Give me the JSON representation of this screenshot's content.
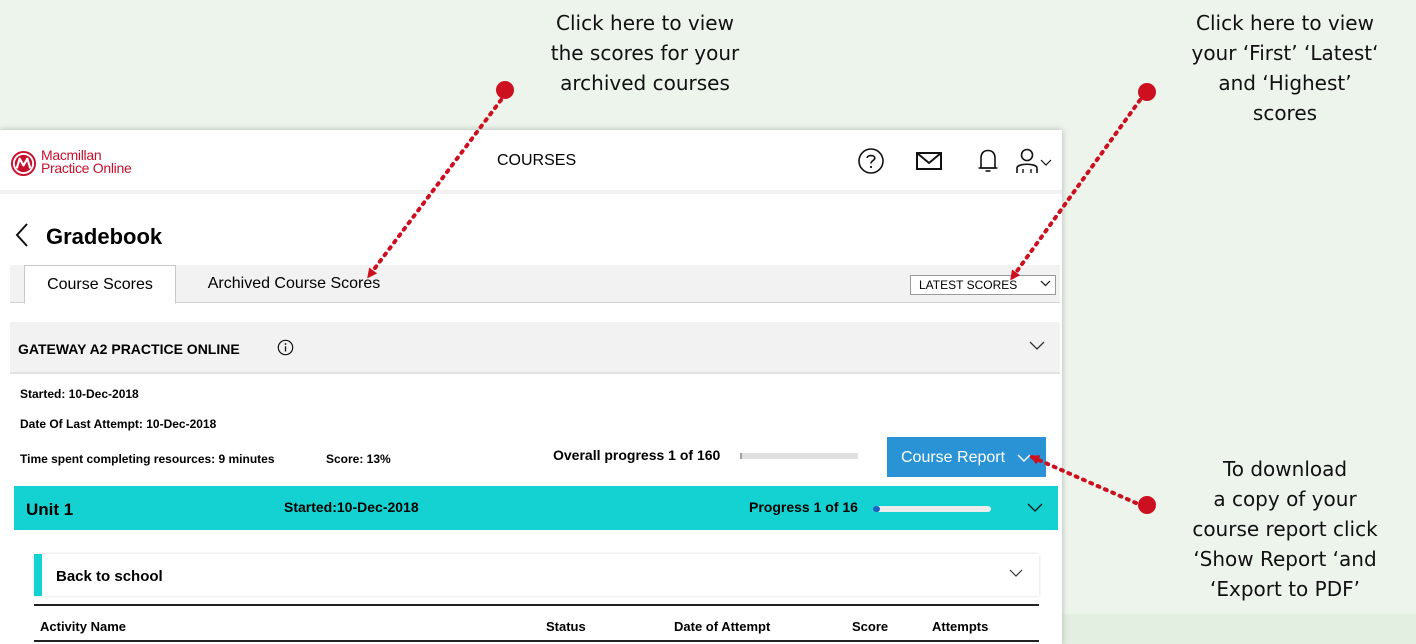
{
  "callouts": {
    "archived": [
      "Click here to view",
      "the scores for your",
      "archived courses"
    ],
    "scores": [
      "Click here to view",
      "your ‘First’ ‘Latest‘",
      "and ‘Highest’",
      "scores"
    ],
    "report": [
      "To download",
      "a copy of your",
      "course report click",
      "‘Show Report ‘and",
      "‘Export to PDF’"
    ]
  },
  "header": {
    "logo_line1": "Macmillan",
    "logo_line2": "Practice Online",
    "nav_label": "COURSES",
    "icons": [
      "help-icon",
      "mail-icon",
      "bell-icon",
      "user-icon",
      "chevron-down-icon"
    ]
  },
  "page": {
    "title": "Gradebook"
  },
  "tabs": [
    {
      "label": "Course Scores",
      "active": true
    },
    {
      "label": "Archived Course Scores",
      "active": false
    }
  ],
  "scores_select": {
    "value": "LATEST SCORES"
  },
  "course": {
    "name": "GATEWAY A2 PRACTICE ONLINE",
    "started": "Started: 10-Dec-2018",
    "last_attempt": "Date Of Last Attempt: 10-Dec-2018",
    "time_spent": "Time spent completing resources: 9 minutes",
    "score": "Score: 13%",
    "overall_progress_label": "Overall progress 1 of 160",
    "overall_progress_fraction": 0.00625,
    "report_button": "Course Report"
  },
  "unit": {
    "name": "Unit 1",
    "started": "Started:10-Dec-2018",
    "progress_label": "Progress 1 of 16",
    "progress_fraction": 0.0625
  },
  "lesson": {
    "name": "Back to school"
  },
  "table": {
    "columns": [
      "Activity Name",
      "Status",
      "Date of Attempt",
      "Score",
      "Attempts"
    ]
  },
  "colors": {
    "accent_teal": "#13d2d1",
    "button_blue": "#2a93d5",
    "annotation_red": "#cc1020",
    "brand_red": "#c8102e"
  }
}
